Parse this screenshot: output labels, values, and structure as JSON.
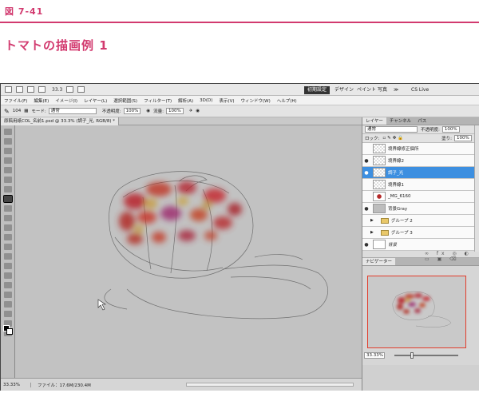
{
  "figure": {
    "label": "図 7-41",
    "title": "トマトの描画例 1"
  },
  "app": {
    "zoom_value": "33.3",
    "workspaces": [
      "初期設定",
      "デザイン",
      "ペイント",
      "写真",
      "≫",
      "CS Live"
    ],
    "menu": [
      "ファイル(F)",
      "編集(E)",
      "イメージ(I)",
      "レイヤー(L)",
      "選択範囲(S)",
      "フィルター(T)",
      "解析(A)",
      "3D(D)",
      "表示(V)",
      "ウィンドウ(W)",
      "ヘルプ(H)"
    ],
    "options": {
      "brush_size": "104",
      "mode_label": "モード:",
      "mode_value": "通常",
      "opacity_label": "不透明度:",
      "opacity_value": "100%",
      "flow_label": "流量:",
      "flow_value": "100%"
    },
    "doc_tab": "原稿用紙COL_名前1.psd @ 33.3% (調子_光, RGB/8) *",
    "status": {
      "zoom": "33.33%",
      "file": "ファイル：17.6M/230.4M"
    }
  },
  "layers_panel": {
    "tabs": [
      "レイヤー",
      "チャンネル",
      "パス"
    ],
    "blend_mode": "通常",
    "opacity_label": "不透明度:",
    "opacity_value": "100%",
    "lock_label": "ロック:",
    "fill_label": "塗り:",
    "fill_value": "100%",
    "layers": [
      {
        "name": "境界線修正個所",
        "visible": false,
        "kind": "normal"
      },
      {
        "name": "境界線2",
        "visible": true,
        "kind": "normal"
      },
      {
        "name": "調子_光",
        "visible": true,
        "kind": "selected"
      },
      {
        "name": "境界線1",
        "visible": false,
        "kind": "normal"
      },
      {
        "name": "_MG_6160",
        "visible": false,
        "kind": "photo"
      },
      {
        "name": "背景Gray",
        "visible": true,
        "kind": "gray"
      },
      {
        "name": "グループ 2",
        "visible": false,
        "kind": "group"
      },
      {
        "name": "グループ 3",
        "visible": false,
        "kind": "group"
      },
      {
        "name": "背景",
        "visible": true,
        "kind": "bg"
      }
    ],
    "bottom_icons": "∞ fx ◎ ◐ ▭ ▣ ⌫"
  },
  "navigator": {
    "tab": "ナビゲーター",
    "zoom_value": "33.33%"
  }
}
